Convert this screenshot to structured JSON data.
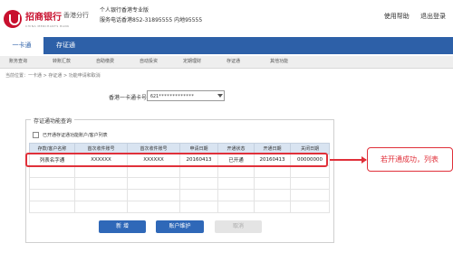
{
  "header": {
    "bank_name": "招商银行",
    "branch": "香港分行",
    "bank_name_en": "CHINA MERCHANTS BANK",
    "info_line1": "个人银行香港专业版",
    "info_line2": "服务电话香港852-31895555 内地95555",
    "links": [
      "使用帮助",
      "退出登录"
    ]
  },
  "nav": {
    "tabs": [
      "一卡通",
      "存证通"
    ],
    "active_tab": "一卡通",
    "subnav": [
      "账务查询",
      "转账汇款",
      "自助缴费",
      "自动投资",
      "定期理财",
      "存证通",
      "其他功能"
    ]
  },
  "breadcrumb": "当前位置：一卡通 > 存证通 > 功能申请和取消",
  "account": {
    "label": "香港一卡通卡号：",
    "value": "621*************"
  },
  "panel": {
    "title": "存证通功能查询",
    "checkbox_label": "已开通存证通功能账户/客户列表"
  },
  "table": {
    "headers": [
      "存款/客户名称",
      "首次收件账号",
      "首次收件账号",
      "申请日期",
      "开通状态",
      "开通日期",
      "关闭日期"
    ],
    "rows": [
      [
        "列表名字通",
        "XXXXXX",
        "XXXXXX",
        "20160413",
        "已开通",
        "20160413",
        "00000000"
      ]
    ]
  },
  "buttons": {
    "new": "新 增",
    "maintain": "账户维护",
    "cancel": "取消"
  },
  "callout": {
    "text": "若开通成功，列表"
  },
  "colors": {
    "brand_red": "#c8102e",
    "nav_blue": "#2d60a8",
    "highlight_red": "#e0303a"
  }
}
